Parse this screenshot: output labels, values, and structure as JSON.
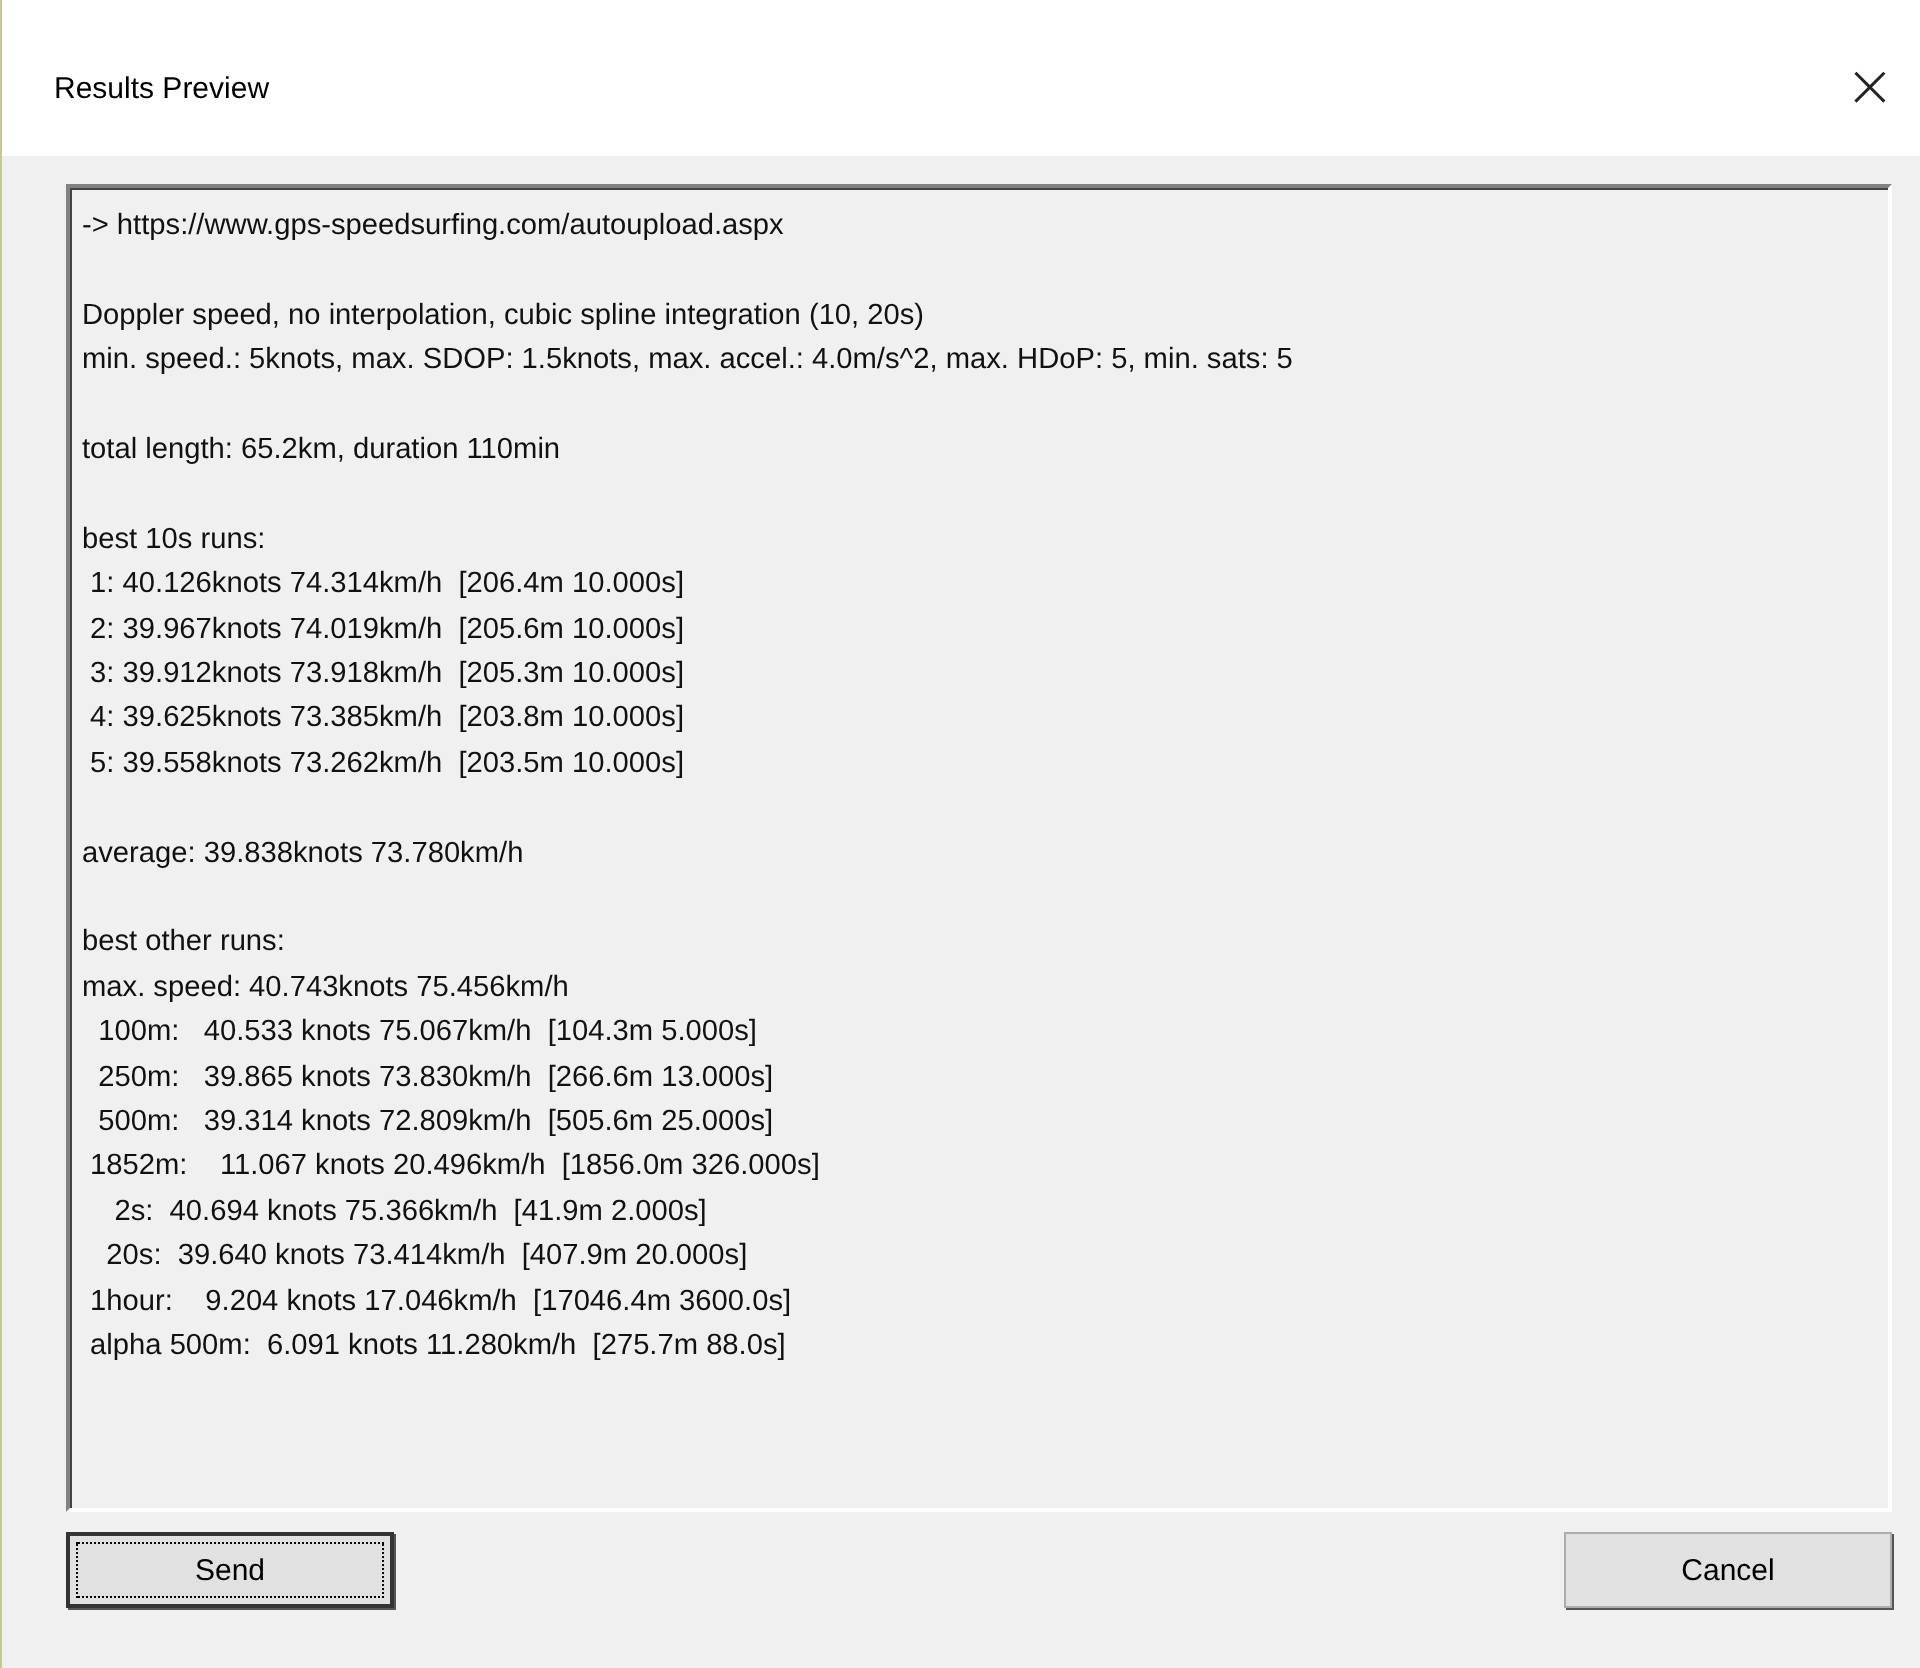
{
  "window": {
    "title": "Results Preview",
    "close": "×"
  },
  "results": {
    "blocks": [
      [
        "-> https://www.gps-speedsurfing.com/autoupload.aspx"
      ],
      [
        "Doppler speed, no interpolation, cubic spline integration (10, 20s)",
        "min. speed.: 5knots, max. SDOP: 1.5knots, max. accel.: 4.0m/s^2, max. HDoP: 5, min. sats: 5"
      ],
      [
        "total length: 65.2km, duration 110min"
      ],
      [
        "best 10s runs:",
        " 1: 40.126knots 74.314km/h  [206.4m 10.000s]",
        " 2: 39.967knots 74.019km/h  [205.6m 10.000s]",
        " 3: 39.912knots 73.918km/h  [205.3m 10.000s]",
        " 4: 39.625knots 73.385km/h  [203.8m 10.000s]",
        " 5: 39.558knots 73.262km/h  [203.5m 10.000s]"
      ],
      [
        "average: 39.838knots 73.780km/h"
      ],
      [
        "best other runs:",
        "max. speed: 40.743knots 75.456km/h",
        "  100m:   40.533 knots 75.067km/h  [104.3m 5.000s]",
        "  250m:   39.865 knots 73.830km/h  [266.6m 13.000s]",
        "  500m:   39.314 knots 72.809km/h  [505.6m 25.000s]",
        " 1852m:    11.067 knots 20.496km/h  [1856.0m 326.000s]",
        "    2s:  40.694 knots 75.366km/h  [41.9m 2.000s]",
        "   20s:  39.640 knots 73.414km/h  [407.9m 20.000s]",
        " 1hour:    9.204 knots 17.046km/h  [17046.4m 3600.0s]",
        " alpha 500m:  6.091 knots 11.280km/h  [275.7m 88.0s]"
      ]
    ]
  },
  "buttons": [
    {
      "label": "Send",
      "focused": true
    },
    {
      "label": "Cancel",
      "focused": false
    }
  ]
}
